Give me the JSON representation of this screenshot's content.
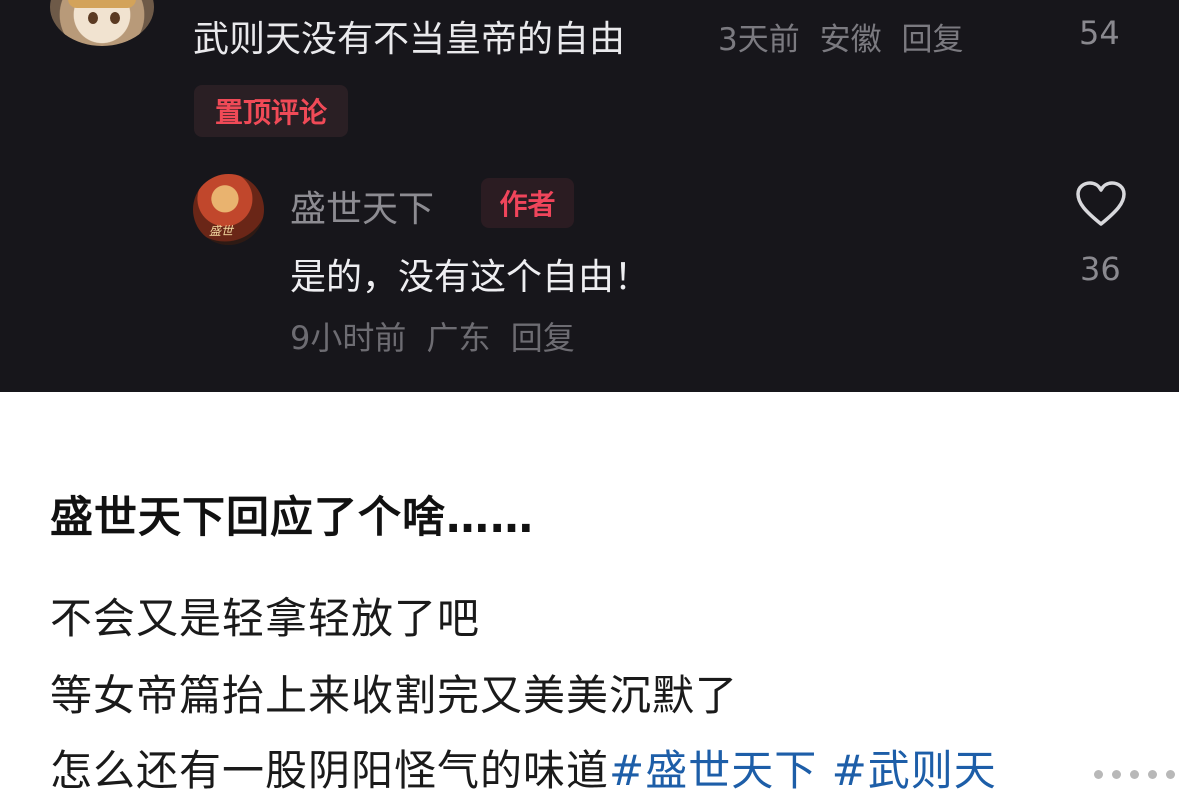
{
  "comment": {
    "text": "武则天没有不当皇帝的自由",
    "time": "3天前",
    "location": "安徽",
    "reply_label": "回复",
    "likes": "54",
    "pin_label": "置顶评论"
  },
  "reply": {
    "username": "盛世天下",
    "author_badge": "作者",
    "text": "是的，没有这个自由！",
    "time": "9小时前",
    "location": "广东",
    "reply_label": "回复",
    "likes": "36"
  },
  "post": {
    "title": "盛世天下回应了个啥……",
    "line1": "不会又是轻拿轻放了吧",
    "line2": "等女帝篇抬上来收割完又美美沉默了",
    "line3_text": "怎么还有一股阴阳怪气的味道",
    "tag1": "#盛世天下",
    "tag2": "#武则天"
  },
  "colors": {
    "dark_bg": "#17161b",
    "badge_red": "#f04a57",
    "hashtag_blue": "#1d5ea8"
  },
  "icons": [
    "heart-icon",
    "more-dots-icon"
  ]
}
